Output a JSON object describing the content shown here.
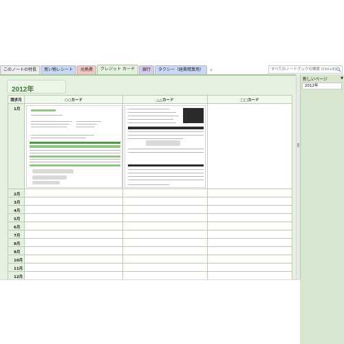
{
  "tabs": [
    {
      "label": "このノートの特長",
      "color": "#ececec"
    },
    {
      "label": "買い物レシート",
      "color": "#c6d8f3"
    },
    {
      "label": "光熱費",
      "color": "#f3c6c6"
    },
    {
      "label": "クレジット カード",
      "color": "#e4f1dc"
    },
    {
      "label": "銀行",
      "color": "#d8c9ef"
    },
    {
      "label": "タクシー（経費精算用）",
      "color": "#c9d8f6"
    }
  ],
  "new_tab_glyph": "+",
  "search": {
    "placeholder": "すべてのノートブックの検索 (Ctrl+E)",
    "icon": "search-icon"
  },
  "page": {
    "title": "2012年",
    "columns": [
      "請求月",
      "○○カード",
      "△△カード",
      "□□カード"
    ],
    "months": [
      "1月",
      "2月",
      "3月",
      "4月",
      "5月",
      "6月",
      "7月",
      "8月",
      "9月",
      "10月",
      "11月",
      "12月"
    ]
  },
  "side": {
    "new_page_label": "新しいページ",
    "dropdown_glyph": "▼",
    "pages": [
      "2012年"
    ]
  },
  "colors": {
    "accent": "#3c7a36",
    "page_bg": "#e6f2e0",
    "side_bg": "#d7e6cf",
    "active_tab": "#e4f1dc"
  }
}
